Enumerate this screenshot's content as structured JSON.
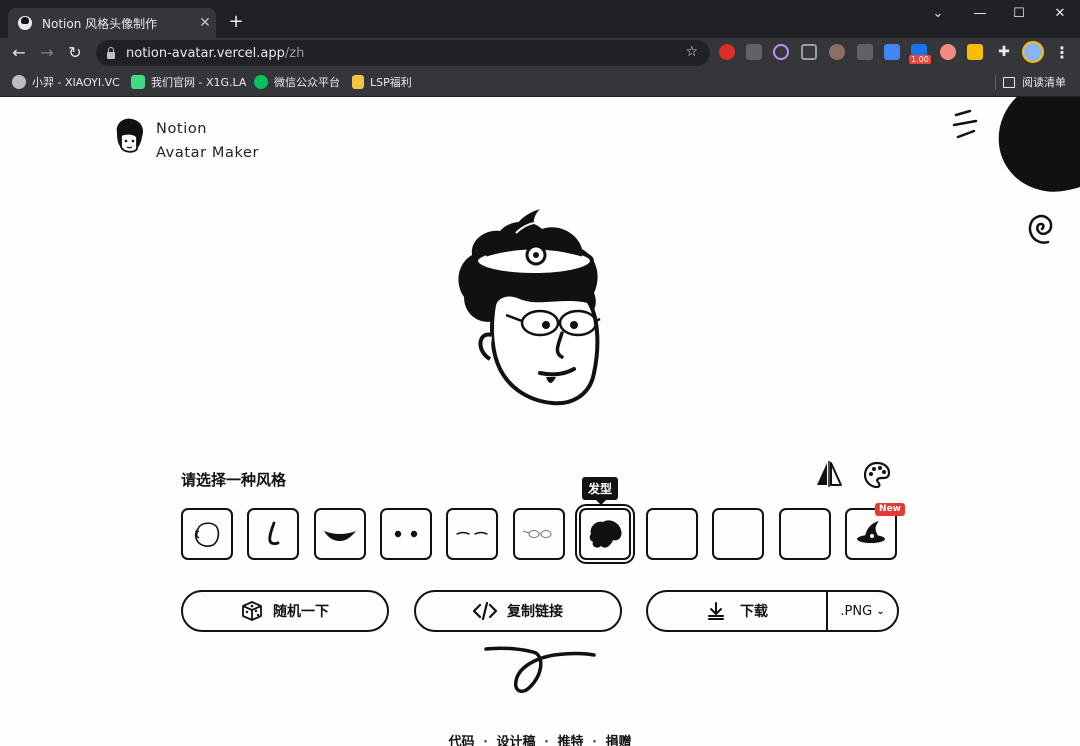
{
  "browser": {
    "tab_title": "Notion 风格头像制作",
    "tab_close": "✕",
    "new_tab": "+",
    "url_host": "notion-avatar.vercel.app",
    "url_path": "/zh",
    "ext_badge": "1.00",
    "bookmarks": [
      {
        "label": "小羿 - XIAOYI.VC",
        "icon_color": "#bdbdbd"
      },
      {
        "label": "我们官网 - X1G.LA",
        "icon_color": "#3ddc84"
      },
      {
        "label": "微信公众平台",
        "icon_color": "#07c160"
      },
      {
        "label": "LSP福利",
        "icon_color": "#f6c244"
      }
    ],
    "reading_list": "阅读清单"
  },
  "logo": {
    "line1": "Notion",
    "line2": "Avatar Maker"
  },
  "section_title": "请选择一种风格",
  "tooltip": "发型",
  "parts": [
    {
      "name": "face",
      "icon": "face-icon"
    },
    {
      "name": "nose",
      "icon": "nose-icon"
    },
    {
      "name": "mouth",
      "icon": "mouth-icon"
    },
    {
      "name": "eyes",
      "icon": "eyes-icon"
    },
    {
      "name": "eyebrows",
      "icon": "eyebrows-icon"
    },
    {
      "name": "glasses",
      "icon": "glasses-icon"
    },
    {
      "name": "hair",
      "icon": "hair-icon",
      "active": true
    },
    {
      "name": "accessories",
      "icon": "empty"
    },
    {
      "name": "details",
      "icon": "empty"
    },
    {
      "name": "beard",
      "icon": "empty"
    },
    {
      "name": "festival",
      "icon": "witch-hat-icon",
      "badge": "New"
    }
  ],
  "actions": {
    "random_label": "随机一下",
    "embed_label": "复制链接",
    "download_label": "下载",
    "format_value": ".PNG"
  },
  "footer": {
    "links": [
      "代码",
      "设计稿",
      "推特",
      "捐赠"
    ],
    "separator": "·"
  },
  "colors": {
    "background": "#fffefc",
    "ink": "#111111",
    "badge": "#e53935"
  }
}
